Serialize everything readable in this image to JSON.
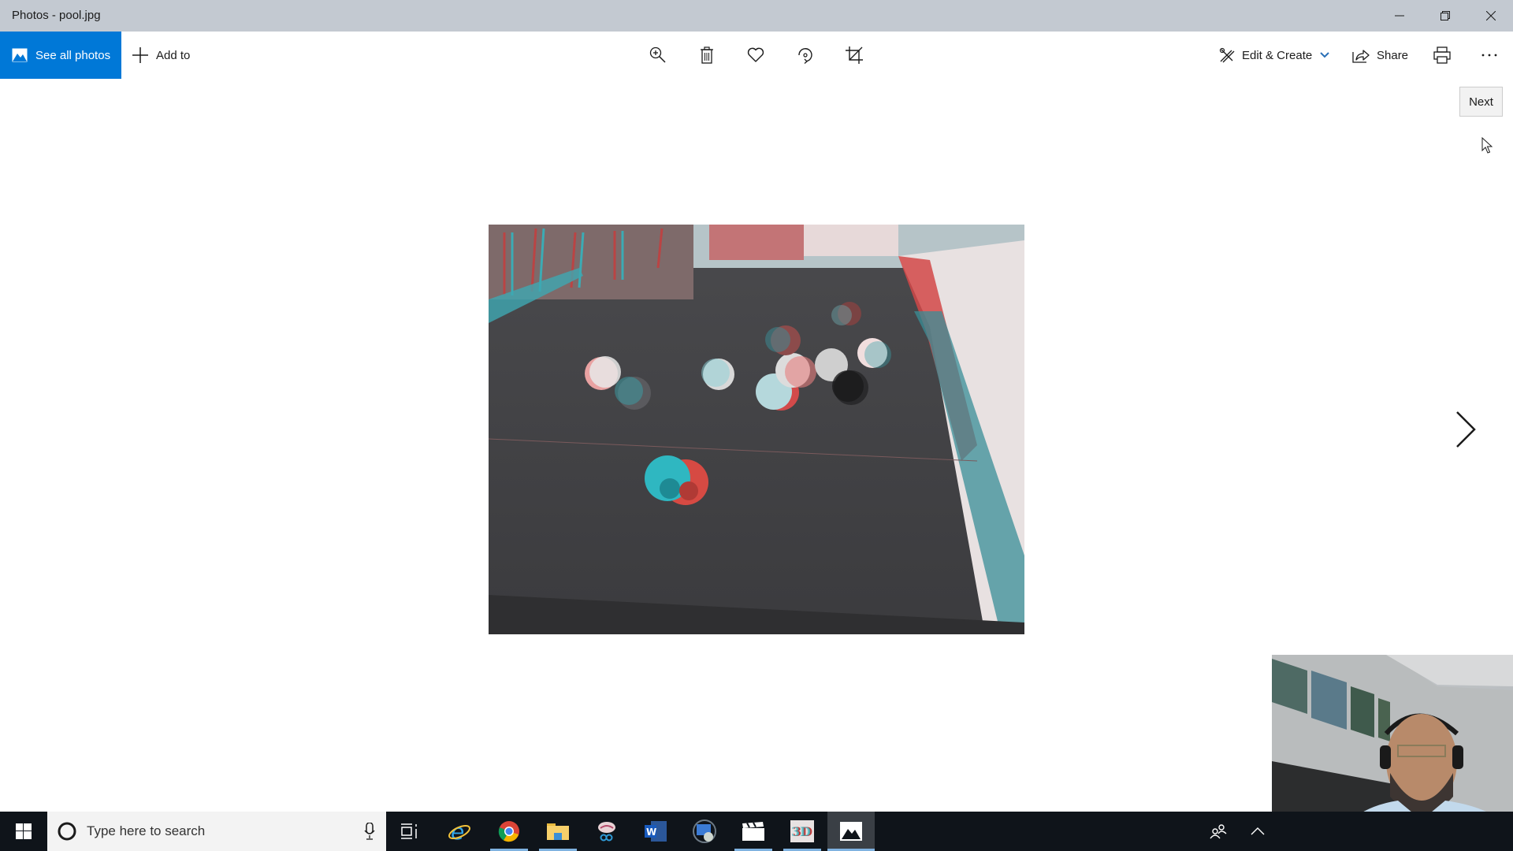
{
  "window": {
    "title": "Photos - pool.jpg",
    "controls": [
      "minimize",
      "restore",
      "close"
    ]
  },
  "toolbar": {
    "see_all_photos_label": "See all photos",
    "add_to_label": "Add to",
    "center_tools": [
      {
        "name": "zoom-in-icon",
        "label": "Zoom"
      },
      {
        "name": "delete-icon",
        "label": "Delete"
      },
      {
        "name": "favorite-icon",
        "label": "Add to favorites"
      },
      {
        "name": "rotate-icon",
        "label": "Rotate"
      },
      {
        "name": "crop-icon",
        "label": "Crop"
      }
    ],
    "edit_create_label": "Edit & Create",
    "share_label": "Share",
    "print_label": "Print",
    "more_label": "See more",
    "accent_color": "#0078d7"
  },
  "viewer": {
    "file_name": "pool.jpg",
    "image_description": "Red-cyan anaglyph photo of billiard balls on a pool table",
    "next_tooltip": "Next"
  },
  "taskbar": {
    "search_placeholder": "Type here to search",
    "pinned": [
      {
        "name": "task-view",
        "running": false
      },
      {
        "name": "internet-explorer",
        "running": false
      },
      {
        "name": "google-chrome",
        "running": true
      },
      {
        "name": "file-explorer",
        "running": true
      },
      {
        "name": "snip-sketch",
        "running": false
      },
      {
        "name": "microsoft-word",
        "running": false
      },
      {
        "name": "remote-desktop",
        "running": false
      },
      {
        "name": "movies-tv",
        "running": true
      },
      {
        "name": "3d-viewer",
        "running": true
      },
      {
        "name": "photos",
        "running": true,
        "active": true
      }
    ]
  }
}
